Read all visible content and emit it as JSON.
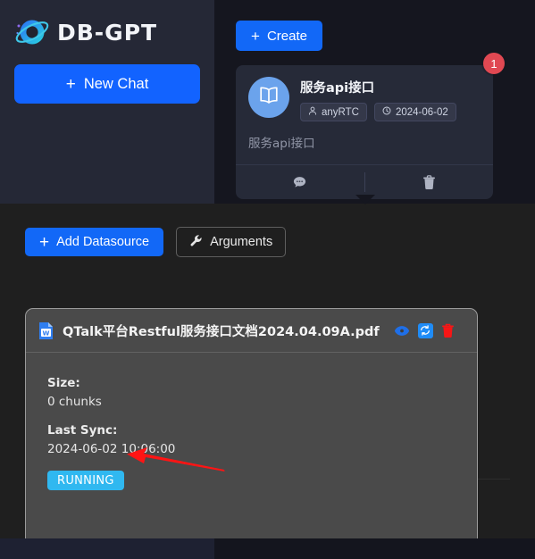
{
  "sidebar": {
    "brand_name": "DB-GPT",
    "brand_logo_icon": "planet-logo-icon",
    "new_chat_label": "New Chat",
    "new_chat_icon": "plus-icon"
  },
  "top_panel": {
    "create_label": "Create",
    "create_icon": "plus-icon",
    "knowledge_card": {
      "badge_count": "1",
      "avatar_icon": "book-icon",
      "title": "服务api接口",
      "owner_icon": "user-icon",
      "owner": "anyRTC",
      "date_icon": "clock-icon",
      "date": "2024-06-02",
      "description": "服务api接口",
      "footer_chat_icon": "chat-bubble-icon",
      "footer_delete_icon": "trash-icon"
    }
  },
  "datasource_panel": {
    "add_datasource_label": "Add Datasource",
    "add_datasource_icon": "plus-icon",
    "arguments_label": "Arguments",
    "arguments_icon": "wrench-icon",
    "document": {
      "file_icon": "word-document-icon",
      "file_name": "QTalk平台Restful服务接口文档2024.04.09A.pdf",
      "view_icon": "eye-icon",
      "sync_icon": "sync-icon",
      "delete_icon": "trash-icon",
      "size_label": "Size:",
      "size_value": "0 chunks",
      "last_sync_label": "Last Sync:",
      "last_sync_value": "2024-06-02 10:06:00",
      "status": "RUNNING",
      "annotation_icon": "red-arrow-annotation"
    }
  },
  "colors": {
    "accent_blue": "#1268f7",
    "sidebar_bg": "#252836",
    "main_bg": "#15161f",
    "card_bg": "#262a38",
    "panel_bg": "#1f1f1f",
    "doc_card_bg": "#4a4a4a",
    "badge_red": "#e04852",
    "status_cyan": "#30b8f0",
    "annotation_red": "#ff1a1a",
    "avatar_blue": "#6ba3ec"
  }
}
